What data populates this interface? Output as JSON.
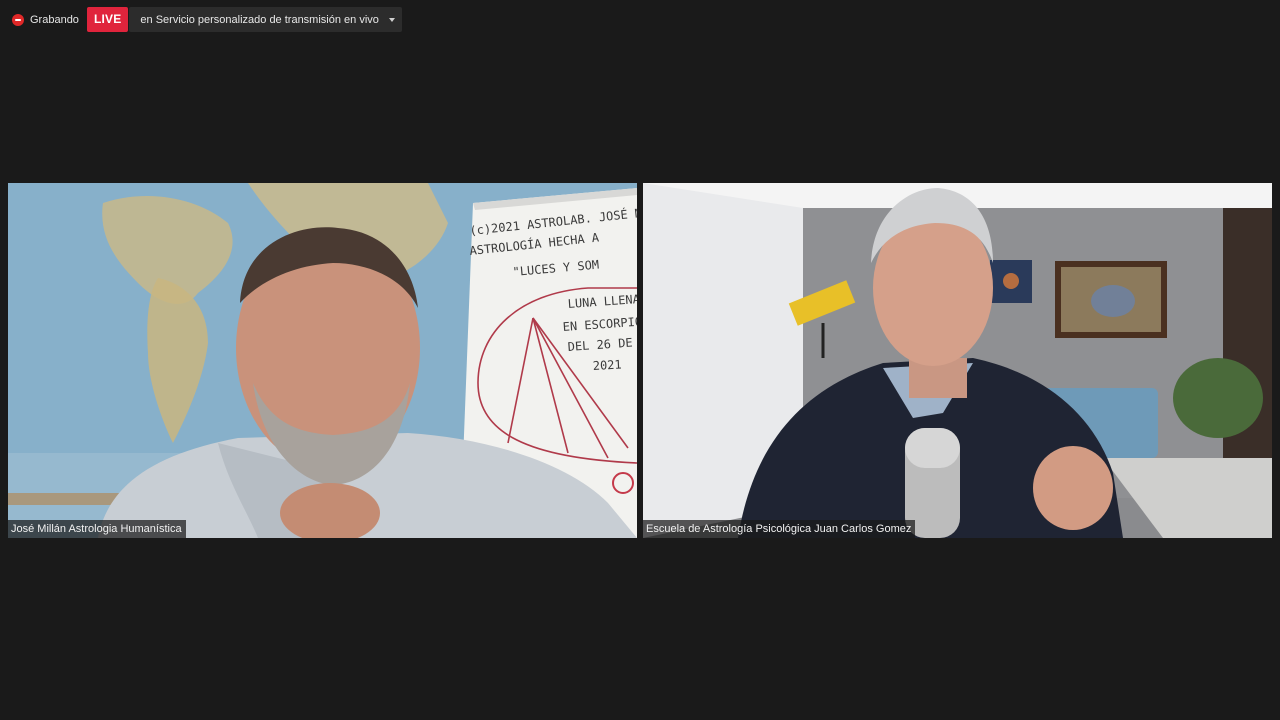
{
  "recording": {
    "label": "Grabando"
  },
  "live": {
    "badge": "LIVE",
    "service_label": "en Servicio personalizado de transmisión en vivo"
  },
  "participants": [
    {
      "name": "José Millán Astrologia Humanística"
    },
    {
      "name": "Escuela de Astrología Psicológica Juan Carlos Gomez"
    }
  ],
  "whiteboard": {
    "lines": [
      "(c)2021 ASTROLAB. JOSÉ M",
      "ASTROLOGÍA HECHA A",
      "\"LUCES Y SOM",
      "LUNA LLENA",
      "EN ESCORPIO",
      "DEL 26 DE",
      "2021"
    ]
  },
  "colors": {
    "live_red": "#e0243c",
    "rec_red": "#e02828",
    "background": "#1a1a1a"
  }
}
